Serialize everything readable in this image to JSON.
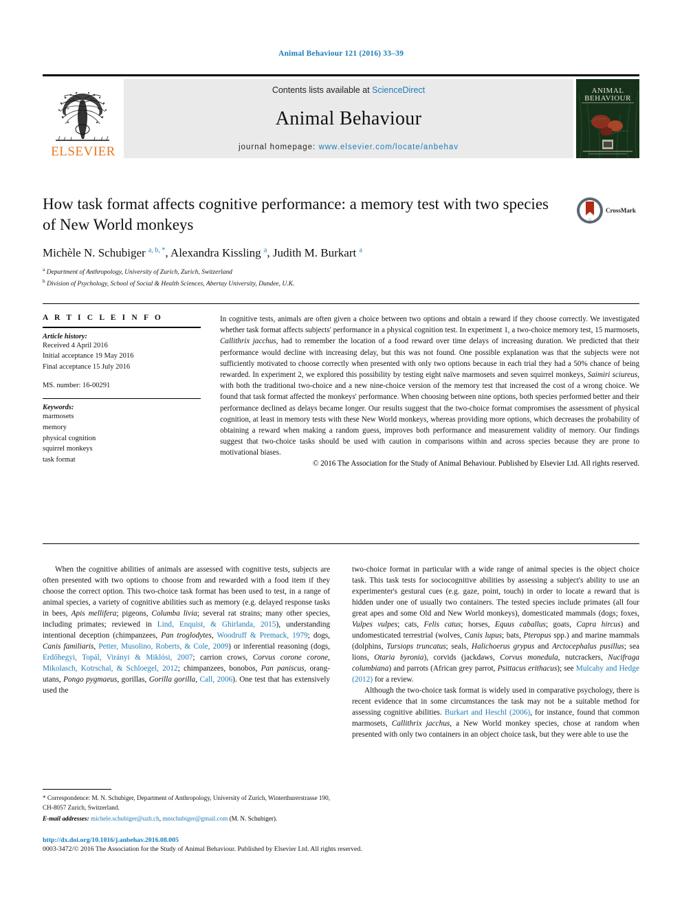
{
  "running_head": "Animal Behaviour 121 (2016) 33–39",
  "masthead": {
    "contents_prefix": "Contents lists available at ",
    "contents_link": "ScienceDirect",
    "journal_name": "Animal Behaviour",
    "homepage_prefix": "journal homepage: ",
    "homepage_url": "www.elsevier.com/locate/anbehav",
    "publisher": "ELSEVIER",
    "publisher_logo_icon": "elsevier-tree-icon",
    "cover_title_line1": "ANIMAL",
    "cover_title_line2": "BEHAVIOUR"
  },
  "article": {
    "title": "How task format affects cognitive performance: a memory test with two species of New World monkeys",
    "crossmark_label": "CrossMark",
    "crossmark_icon": "crossmark-icon",
    "authors_html": "Michèle N. Schubiger <sup>a, b, *</sup>, Alexandra Kissling <sup>a</sup>, Judith M. Burkart <sup>a</sup>",
    "affiliation_a": "Department of Anthropology, University of Zurich, Zurich, Switzerland",
    "affiliation_b": "Division of Psychology, School of Social & Health Sciences, Abertay University, Dundee, U.K."
  },
  "article_info": {
    "heading": "A R T I C L E   I N F O",
    "history_label": "Article history:",
    "history": [
      "Received 4 April 2016",
      "Initial acceptance 19 May 2016",
      "Final acceptance 15 July 2016"
    ],
    "ms_number": "MS. number: 16-00291",
    "keywords_label": "Keywords:",
    "keywords": [
      "marmosets",
      "memory",
      "physical cognition",
      "squirrel monkeys",
      "task format"
    ]
  },
  "abstract": {
    "paragraph_html": "In cognitive tests, animals are often given a choice between two options and obtain a reward if they choose correctly. We investigated whether task format affects subjects' performance in a physical cognition test. In experiment 1, a two-choice memory test, 15 marmosets, <i>Callithrix jacchus</i>, had to remember the location of a food reward over time delays of increasing duration. We predicted that their performance would decline with increasing delay, but this was not found. One possible explanation was that the subjects were not sufficiently motivated to choose correctly when presented with only two options because in each trial they had a 50% chance of being rewarded. In experiment 2, we explored this possibility by testing eight naïve marmosets and seven squirrel monkeys, <i>Saimiri sciureus</i>, with both the traditional two-choice and a new nine-choice version of the memory test that increased the cost of a wrong choice. We found that task format affected the monkeys' performance. When choosing between nine options, both species performed better and their performance declined as delays became longer. Our results suggest that the two-choice format compromises the assessment of physical cognition, at least in memory tests with these New World monkeys, whereas providing more options, which decreases the probability of obtaining a reward when making a random guess, improves both performance and measurement validity of memory. Our findings suggest that two-choice tasks should be used with caution in comparisons within and across species because they are prone to motivational biases.",
    "copyright": "© 2016 The Association for the Study of Animal Behaviour. Published by Elsevier Ltd. All rights reserved."
  },
  "body": {
    "left_paragraph_html": "When the cognitive abilities of animals are assessed with cognitive tests, subjects are often presented with two options to choose from and rewarded with a food item if they choose the correct option. This two-choice task format has been used to test, in a range of animal species, a variety of cognitive abilities such as memory (e.g. delayed response tasks in bees, <i>Apis mellifera</i>; pigeons, <i>Columba livia</i>; several rat strains; many other species, including primates; reviewed in <a class=\"ref\" href=\"#\">Lind, Enquist, &amp; Ghirlanda, 2015</a>), understanding intentional deception (chimpanzees, <i>Pan troglodytes</i>, <a class=\"ref\" href=\"#\">Woodruff &amp; Premack, 1979</a>; dogs, <i>Canis familiaris</i>, <a class=\"ref\" href=\"#\">Petter, Musolino, Roberts, &amp; Cole, 2009</a>) or inferential reasoning (dogs, <a class=\"ref\" href=\"#\">Erdőhegyi, Topál, Virányi &amp; Miklósi, 2007</a>; carrion crows, <i>Corvus corone corone</i>, <a class=\"ref\" href=\"#\">Mikolasch, Kotrschal, &amp; Schloegel, 2012</a>; chimpanzees, bonobos, <i>Pan paniscus</i>, orang-utans, <i>Pongo pygmaeus</i>, gorillas, <i>Gorilla gorilla</i>, <a class=\"ref\" href=\"#\">Call, 2006</a>). One test that has extensively used the",
    "right_paragraph1_html": "two-choice format in particular with a wide range of animal species is the object choice task. This task tests for sociocognitive abilities by assessing a subject's ability to use an experimenter's gestural cues (e.g. gaze, point, touch) in order to locate a reward that is hidden under one of usually two containers. The tested species include primates (all four great apes and some Old and New World monkeys), domesticated mammals (dogs; foxes, <i>Vulpes vulpes</i>; cats, <i>Felis catus</i>; horses, <i>Equus caballus</i>; goats, <i>Capra hircus</i>) and undomesticated terrestrial (wolves, <i>Canis lupus</i>; bats, <i>Pteropus</i> spp.) and marine mammals (dolphins, <i>Tursiops truncatus</i>; seals, <i>Halichoerus grypus</i> and <i>Arctocephalus pusillus</i>; sea lions, <i>Otaria byronia</i>), corvids (jackdaws, <i>Corvus monedula</i>, nutcrackers, <i>Nucifraga columbiana</i>) and parrots (African grey parrot, <i>Psittacus erithacus</i>); see <a class=\"ref\" href=\"#\">Mulcahy and Hedge (2012)</a> for a review.",
    "right_paragraph2_html": "Although the two-choice task format is widely used in comparative psychology, there is recent evidence that in some circumstances the task may not be a suitable method for assessing cognitive abilities. <a class=\"ref\" href=\"#\">Burkart and Heschl (2006)</a>, for instance, found that common marmosets, <i>Callithrix jacchus</i>, a New World monkey species, chose at random when presented with only two containers in an object choice task, but they were able to use the"
  },
  "footnotes": {
    "correspondence_html": "<span class=\"star\">*</span> Correspondence: M. N. Schubiger, Department of Anthropology, University of Zurich, Winterthurerstrasse 190, CH-8057 Zurich, Switzerland.",
    "email_label": "E-mail addresses:",
    "email1": "michele.schubiger@uzh.ch",
    "email2": "mnschubiger@gmail.com",
    "email_attrib": "(M. N. Schubiger)."
  },
  "footer": {
    "doi": "http://dx.doi.org/10.1016/j.anbehav.2016.08.005",
    "issn_line": "0003-3472/© 2016 The Association for the Study of Animal Behaviour. Published by Elsevier Ltd. All rights reserved."
  },
  "colors": {
    "link": "#1a7bb9",
    "elsevier_orange": "#E87722",
    "masthead_bg": "#eaeaea"
  }
}
